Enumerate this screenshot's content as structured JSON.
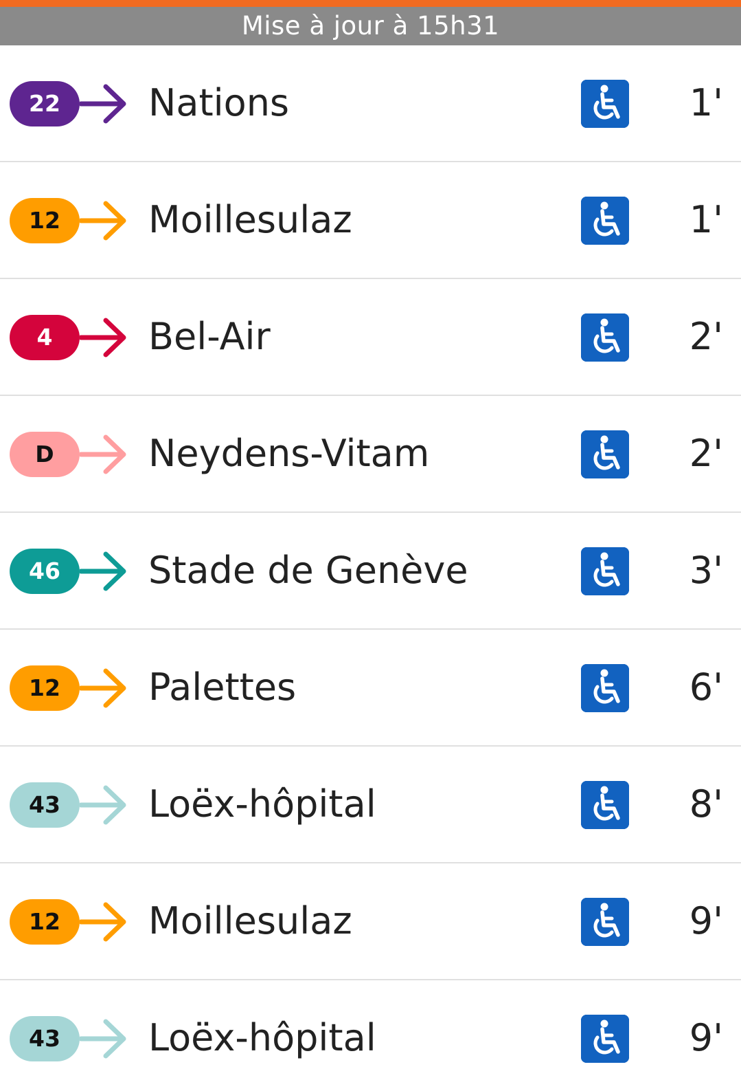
{
  "header": {
    "accent_color": "#f26b21",
    "update_text": "Mise à jour à 15h31"
  },
  "departures": [
    {
      "line": "22",
      "line_color": "#5e2590",
      "text_color": "#ffffff",
      "destination": "Nations",
      "accessible_icon": "wheelchair-icon",
      "wait": "1'"
    },
    {
      "line": "12",
      "line_color": "#ff9d00",
      "text_color": "#111111",
      "destination": "Moillesulaz",
      "accessible_icon": "wheelchair-icon",
      "wait": "1'"
    },
    {
      "line": "4",
      "line_color": "#d4043c",
      "text_color": "#ffffff",
      "destination": "Bel-Air",
      "accessible_icon": "wheelchair-icon",
      "wait": "2'"
    },
    {
      "line": "D",
      "line_color": "#ff9ea0",
      "text_color": "#111111",
      "destination": "Neydens-Vitam",
      "accessible_icon": "wheelchair-icon",
      "wait": "2'"
    },
    {
      "line": "46",
      "line_color": "#0e9c96",
      "text_color": "#ffffff",
      "destination": "Stade de Genève",
      "accessible_icon": "wheelchair-icon",
      "wait": "3'"
    },
    {
      "line": "12",
      "line_color": "#ff9d00",
      "text_color": "#111111",
      "destination": "Palettes",
      "accessible_icon": "wheelchair-icon",
      "wait": "6'"
    },
    {
      "line": "43",
      "line_color": "#a5d6d6",
      "text_color": "#111111",
      "destination": "Loëx-hôpital",
      "accessible_icon": "wheelchair-icon",
      "wait": "8'"
    },
    {
      "line": "12",
      "line_color": "#ff9d00",
      "text_color": "#111111",
      "destination": "Moillesulaz",
      "accessible_icon": "wheelchair-icon",
      "wait": "9'"
    },
    {
      "line": "43",
      "line_color": "#a5d6d6",
      "text_color": "#111111",
      "destination": "Loëx-hôpital",
      "accessible_icon": "wheelchair-icon",
      "wait": "9'"
    }
  ]
}
